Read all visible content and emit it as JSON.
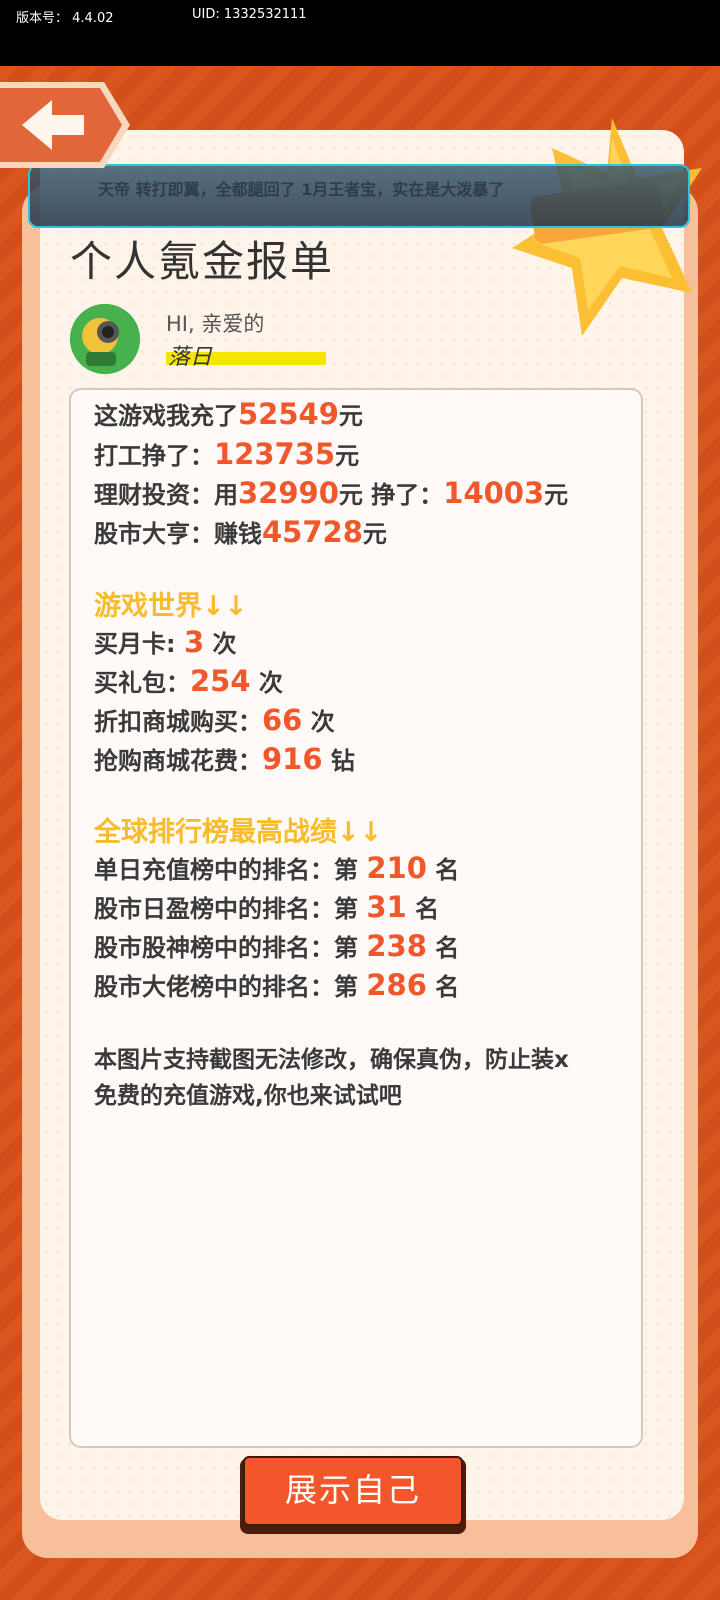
{
  "status_bar": {
    "version_label": "版本号：  4.4.02",
    "uid_label": "UID: 1332532111"
  },
  "ticker": {
    "text": "天帝 转打即翼，全都腿回了 1月王者宝，实在是大泼暴了"
  },
  "page": {
    "title": "个人氪金报单",
    "greeting": "HI, 亲爱的",
    "username": "落日"
  },
  "report": {
    "recharge": {
      "prefix": "这游戏我充了",
      "value": "52549",
      "suffix": "元"
    },
    "work": {
      "prefix": "打工挣了：",
      "value": "123735",
      "suffix": "元"
    },
    "finance": {
      "prefix": "理财投资：用",
      "value": "32990",
      "mid": "元 挣了：",
      "value2": "14003",
      "suffix": "元"
    },
    "stock": {
      "prefix": "股市大亨：赚钱",
      "value": "45728",
      "suffix": "元"
    },
    "game_world_header": "游戏世界↓↓",
    "month_card": {
      "prefix": "买月卡: ",
      "value": "3",
      "suffix": " 次"
    },
    "gift_pack": {
      "prefix": "买礼包：",
      "value": "254",
      "suffix": " 次"
    },
    "discount_shop": {
      "prefix": "折扣商城购买：",
      "value": "66",
      "suffix": " 次"
    },
    "rush_shop": {
      "prefix": "抢购商城花费：",
      "value": "916",
      "suffix": " 钻"
    },
    "ranking_header": "全球排行榜最高战绩↓↓",
    "rank_recharge": {
      "prefix": "单日充值榜中的排名：第 ",
      "value": "210",
      "suffix": " 名"
    },
    "rank_profit": {
      "prefix": "股市日盈榜中的排名：第 ",
      "value": "31",
      "suffix": " 名"
    },
    "rank_god": {
      "prefix": "股市股神榜中的排名：第 ",
      "value": "238",
      "suffix": " 名"
    },
    "rank_boss": {
      "prefix": "股市大佬榜中的排名：第 ",
      "value": "286",
      "suffix": " 名"
    },
    "footer_line1": "本图片支持截图无法修改，确保真伪，防止装x",
    "footer_line2": "免费的充值游戏,你也来试试吧"
  },
  "buttons": {
    "show_self": "展示自己"
  },
  "colors": {
    "accent_number": "#f0572a",
    "section_header": "#f8bb2a",
    "background": "#d8541f"
  }
}
